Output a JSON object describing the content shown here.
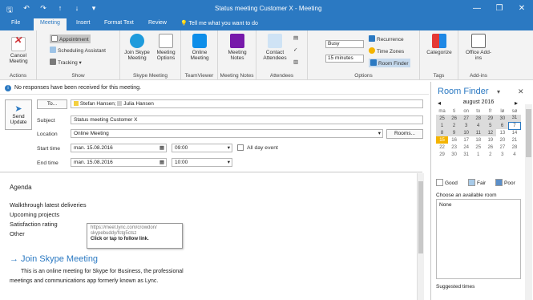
{
  "window": {
    "title": "Status meeting Customer X - Meeting",
    "minimize": "—",
    "restore": "❐",
    "close": "✕"
  },
  "qat": {
    "save": "🖫",
    "undo": "↶",
    "redo": "↷",
    "up": "↑",
    "down": "↓",
    "more": "▾"
  },
  "tabs": [
    "File",
    "Meeting",
    "Insert",
    "Format Text",
    "Review"
  ],
  "tell_me": "Tell me what you want to do",
  "ribbon": {
    "actions": {
      "label": "Actions",
      "cancel": "Cancel Meeting"
    },
    "show": {
      "label": "Show",
      "appointment": "Appointment",
      "scheduling": "Scheduling Assistant",
      "tracking": "Tracking"
    },
    "skype": {
      "label": "Skype Meeting",
      "join": "Join Skype Meeting",
      "options": "Meeting Options"
    },
    "teamviewer": {
      "label": "TeamViewer",
      "online": "Online Meeting"
    },
    "notes": {
      "label": "Meeting Notes",
      "notes": "Meeting Notes"
    },
    "attendees": {
      "label": "Attendees",
      "contact": "Contact Attendees",
      "icon_a": "▤",
      "icon_b": "✓",
      "icon_c": "▥"
    },
    "options": {
      "label": "Options",
      "busy": "Busy",
      "reminder": "15 minutes",
      "recurrence": "Recurrence",
      "timezones": "Time Zones",
      "roomfinder": "Room Finder"
    },
    "tags": {
      "label": "Tags",
      "categorize": "Categorize"
    },
    "addins": {
      "label": "Add-ins",
      "office": "Office Add-ins"
    }
  },
  "infobar": {
    "text": "No responses have been received for this meeting."
  },
  "form": {
    "send": "Send Update",
    "to_btn": "To...",
    "attendees": [
      "Stefan Hansen",
      "Julia Hansen"
    ],
    "subject_label": "Subject",
    "subject": "Status meeting Customer X",
    "location_label": "Location",
    "location": "Online Meeting",
    "rooms_btn": "Rooms...",
    "start_label": "Start time",
    "start_date": "man. 15.08.2016",
    "start_time": "09:00",
    "end_label": "End time",
    "end_date": "man. 15.08.2016",
    "end_time": "10:00",
    "allday": "All day event"
  },
  "body": {
    "agenda": "Agenda",
    "item1": "Walkthrough latest deliveries",
    "item2": "Upcoming projects",
    "item3": "Satisfaction rating",
    "item4": "Other",
    "join_link": "→ Join Skype Meeting",
    "trouble": "This is an online meeting for Skype for Business, the professional",
    "trouble2": "meetings and communications app formerly known as Lync.",
    "tooltip_url": "https://meet.lync.com/crowdon/",
    "tooltip_url2": "skypebuddy/fctg5ctsz",
    "tooltip_hint": "Click or tap to follow link."
  },
  "roomfinder": {
    "title": "Room Finder",
    "month": "august 2016",
    "weekdays": [
      "ma",
      "ti",
      "on",
      "to",
      "fr",
      "lø",
      "sø"
    ],
    "weeks": [
      [
        "25",
        "26",
        "27",
        "28",
        "29",
        "30",
        "31"
      ],
      [
        "1",
        "2",
        "3",
        "4",
        "5",
        "6",
        "7"
      ],
      [
        "8",
        "9",
        "10",
        "11",
        "12",
        "13",
        "14"
      ],
      [
        "15",
        "16",
        "17",
        "18",
        "19",
        "20",
        "21"
      ],
      [
        "22",
        "23",
        "24",
        "25",
        "26",
        "27",
        "28"
      ],
      [
        "29",
        "30",
        "31",
        "1",
        "2",
        "3",
        "4"
      ]
    ],
    "good": "Good",
    "fair": "Fair",
    "poor": "Poor",
    "choose": "Choose an available room",
    "room": "None",
    "suggested": "Suggested times"
  }
}
